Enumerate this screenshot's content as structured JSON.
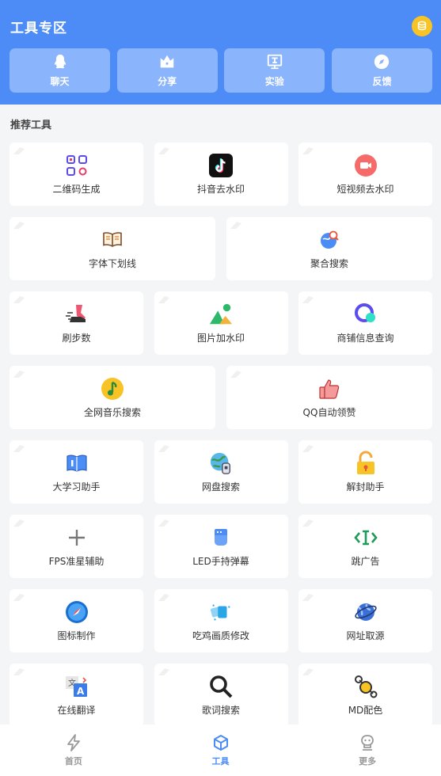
{
  "header": {
    "title": "工具专区",
    "coin_icon": "coin-icon",
    "accent": "#4d8cf7"
  },
  "top_actions": [
    {
      "label": "聊天",
      "icon": "qq-penguin-icon"
    },
    {
      "label": "分享",
      "icon": "crown-icon"
    },
    {
      "label": "实验",
      "icon": "lab-icon"
    },
    {
      "label": "反馈",
      "icon": "compass-icon"
    }
  ],
  "section": {
    "title": "推荐工具"
  },
  "tools": [
    {
      "label": "二维码生成",
      "icon": "qrcode-icon"
    },
    {
      "label": "抖音去水印",
      "icon": "tiktok-icon"
    },
    {
      "label": "短视频去水印",
      "icon": "video-camera-icon"
    },
    {
      "label": "字体下划线",
      "icon": "book-icon"
    },
    {
      "label": "聚合搜索",
      "icon": "globe-search-icon"
    },
    {
      "label": "刷步数",
      "icon": "running-shoe-icon"
    },
    {
      "label": "图片加水印",
      "icon": "mountain-image-icon"
    },
    {
      "label": "商铺信息查询",
      "icon": "shop-search-icon"
    },
    {
      "label": "全网音乐搜索",
      "icon": "music-note-icon"
    },
    {
      "label": "QQ自动领赞",
      "icon": "thumbs-up-icon"
    },
    {
      "label": "大学习助手",
      "icon": "study-book-icon"
    },
    {
      "label": "网盘搜索",
      "icon": "cloud-disk-icon"
    },
    {
      "label": "解封助手",
      "icon": "unlock-icon"
    },
    {
      "label": "FPS准星辅助",
      "icon": "crosshair-plus-icon"
    },
    {
      "label": "LED手持弹幕",
      "icon": "led-hand-icon"
    },
    {
      "label": "跳广告",
      "icon": "skip-ad-icon"
    },
    {
      "label": "图标制作",
      "icon": "safari-icon"
    },
    {
      "label": "吃鸡画质修改",
      "icon": "paint-quality-icon"
    },
    {
      "label": "网址取源",
      "icon": "planet-icon"
    },
    {
      "label": "在线翻译",
      "icon": "translate-icon"
    },
    {
      "label": "歌词搜索",
      "icon": "magnifier-icon"
    },
    {
      "label": "MD配色",
      "icon": "palette-node-icon"
    }
  ],
  "bottom_nav": [
    {
      "label": "首页",
      "icon": "lightning-icon",
      "active": false
    },
    {
      "label": "工具",
      "icon": "cube-icon",
      "active": true
    },
    {
      "label": "更多",
      "icon": "robot-icon",
      "active": false
    }
  ]
}
